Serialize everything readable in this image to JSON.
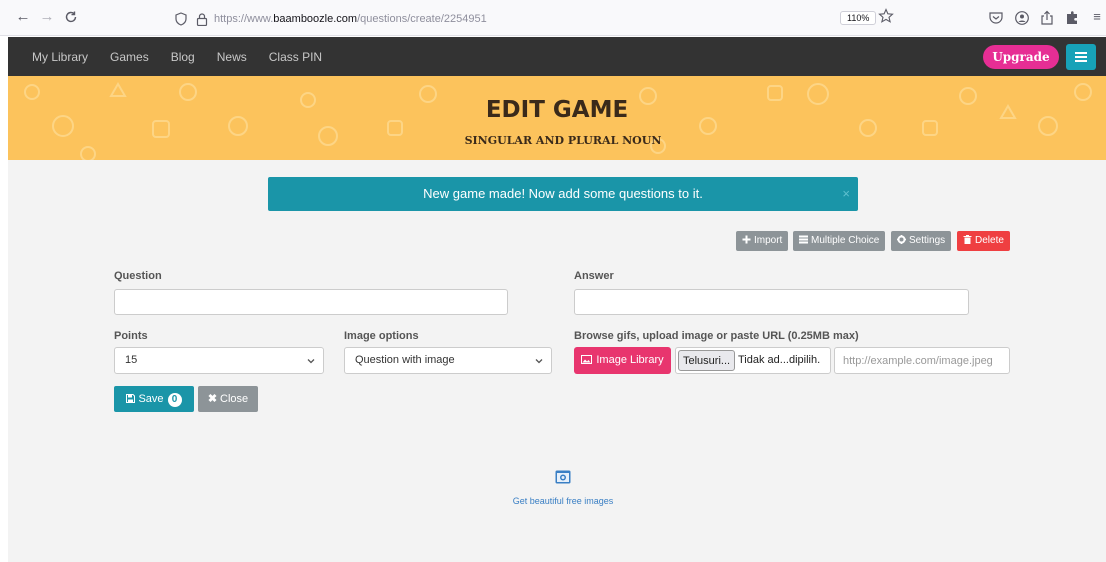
{
  "browser": {
    "url_prefix": "https://www.",
    "url_domain": "baamboozle.com",
    "url_path": "/questions/create/2254951",
    "zoom": "110%"
  },
  "site_nav": {
    "links": [
      "My Library",
      "Games",
      "Blog",
      "News",
      "Class PIN"
    ],
    "upgrade_label": "Upgrade",
    "upgrade_color": "#e62e94",
    "menu_color": "#17a2b8"
  },
  "header": {
    "title": "Edit Game",
    "subtitle": "SINGULAR AND PLURAL NOUN",
    "background": "#fcc35c"
  },
  "alert": {
    "message": "New game made! Now add some questions to it.",
    "close_symbol": "×"
  },
  "toolbar": {
    "import_label": "Import",
    "multiple_choice_label": "Multiple Choice",
    "settings_label": "Settings",
    "delete_label": "Delete"
  },
  "form": {
    "question_label": "Question",
    "question_value": "",
    "answer_label": "Answer",
    "answer_value": "",
    "points_label": "Points",
    "points_value": "15",
    "image_options_label": "Image options",
    "image_options_value": "Question with image",
    "browse_label": "Browse gifs, upload image or paste URL (0.25MB max)",
    "image_library_label": "Image Library",
    "file_browse_label": "Telusuri...",
    "file_status": "Tidak ad...dipilih.",
    "image_url_placeholder": "http://example.com/image.jpeg"
  },
  "actions": {
    "save_label": "Save",
    "save_count": "0",
    "close_label": "Close"
  },
  "footer": {
    "free_images_link": "Get beautiful free images"
  }
}
